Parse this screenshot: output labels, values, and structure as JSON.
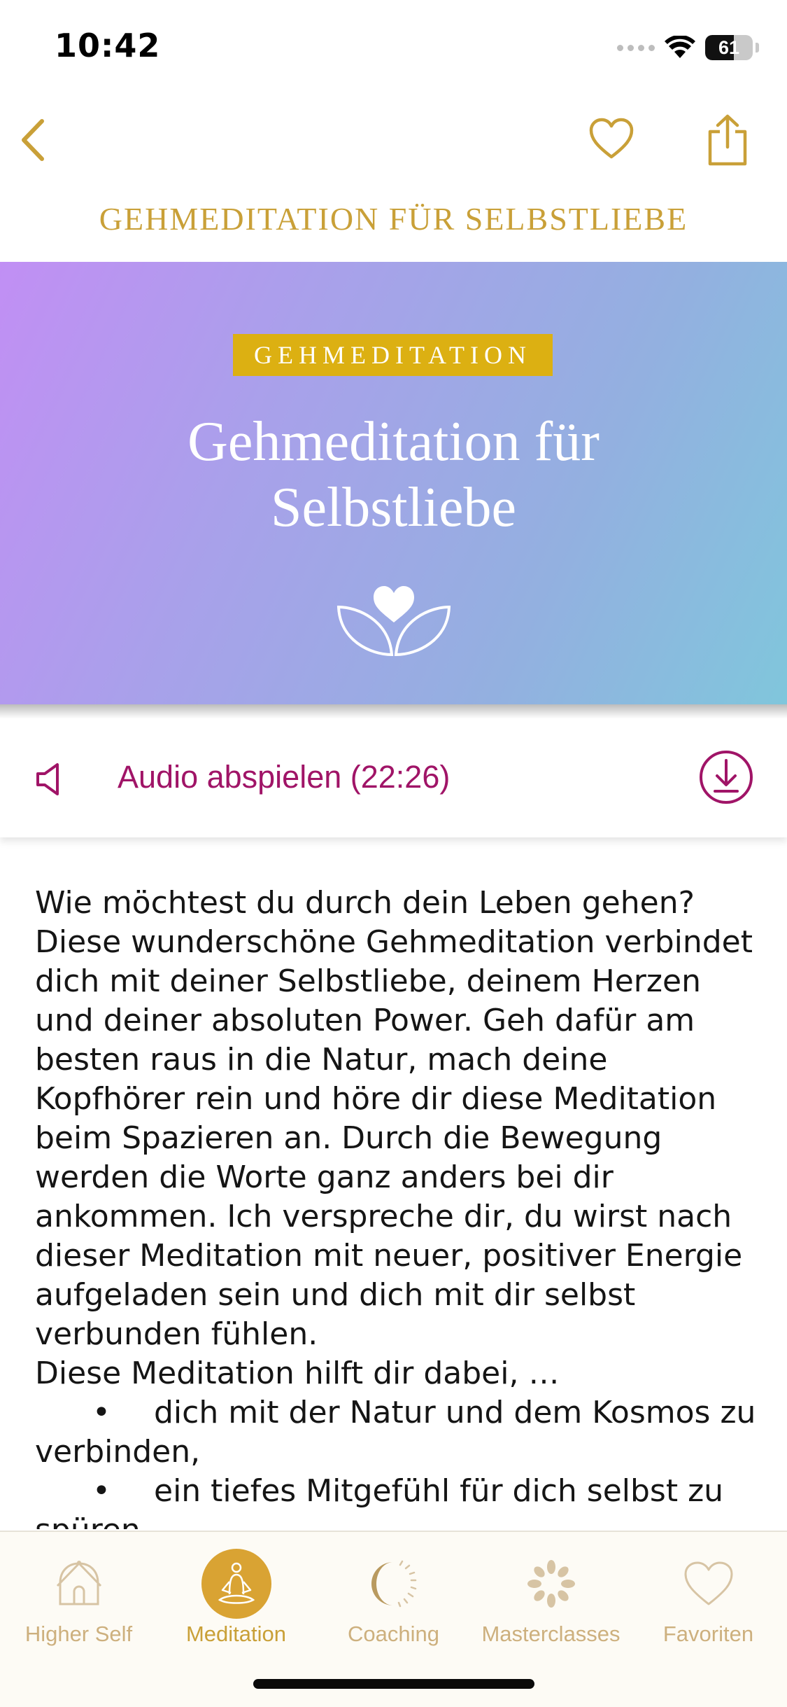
{
  "status_bar": {
    "time": "10:42",
    "battery": "61",
    "battery_level": 0.61
  },
  "nav": {
    "title": "GEHMEDITATION FÜR SELBSTLIEBE"
  },
  "hero": {
    "tag": "GEHMEDITATION",
    "title_line1": "Gehmeditation für",
    "title_line2": "Selbstliebe"
  },
  "audio": {
    "label": "Audio abspielen (22:26)"
  },
  "description": {
    "paragraph": "Wie möchtest du durch dein Leben gehen? Diese wunderschöne Gehmeditation verbindet dich mit deiner Selbstliebe, deinem Herzen und deiner absoluten Power. Geh dafür am besten raus in die Natur, mach deine Kopfhörer rein und höre dir diese Meditation beim Spazieren an. Durch die Bewegung werden die Worte ganz anders bei dir ankommen. Ich verspreche dir, du wirst nach dieser Meditation mit neuer, positiver Energie aufgeladen sein und dich mit dir selbst verbunden fühlen.",
    "intro": "Diese Meditation hilft dir dabei, …",
    "bullets": [
      "dich mit der Natur und dem Kosmos zu verbinden,",
      "ein tiefes Mitgefühl für dich selbst zu spüren,"
    ]
  },
  "tabs": [
    {
      "label": "Higher Self",
      "icon": "house-icon"
    },
    {
      "label": "Meditation",
      "icon": "meditation-icon"
    },
    {
      "label": "Coaching",
      "icon": "moon-sun-icon"
    },
    {
      "label": "Masterclasses",
      "icon": "flower-icon"
    },
    {
      "label": "Favoriten",
      "icon": "heart-icon"
    }
  ],
  "colors": {
    "gold": "#c9a038",
    "accent": "#a01467",
    "tag": "#dcb012",
    "tab_active": "#d9a333"
  }
}
